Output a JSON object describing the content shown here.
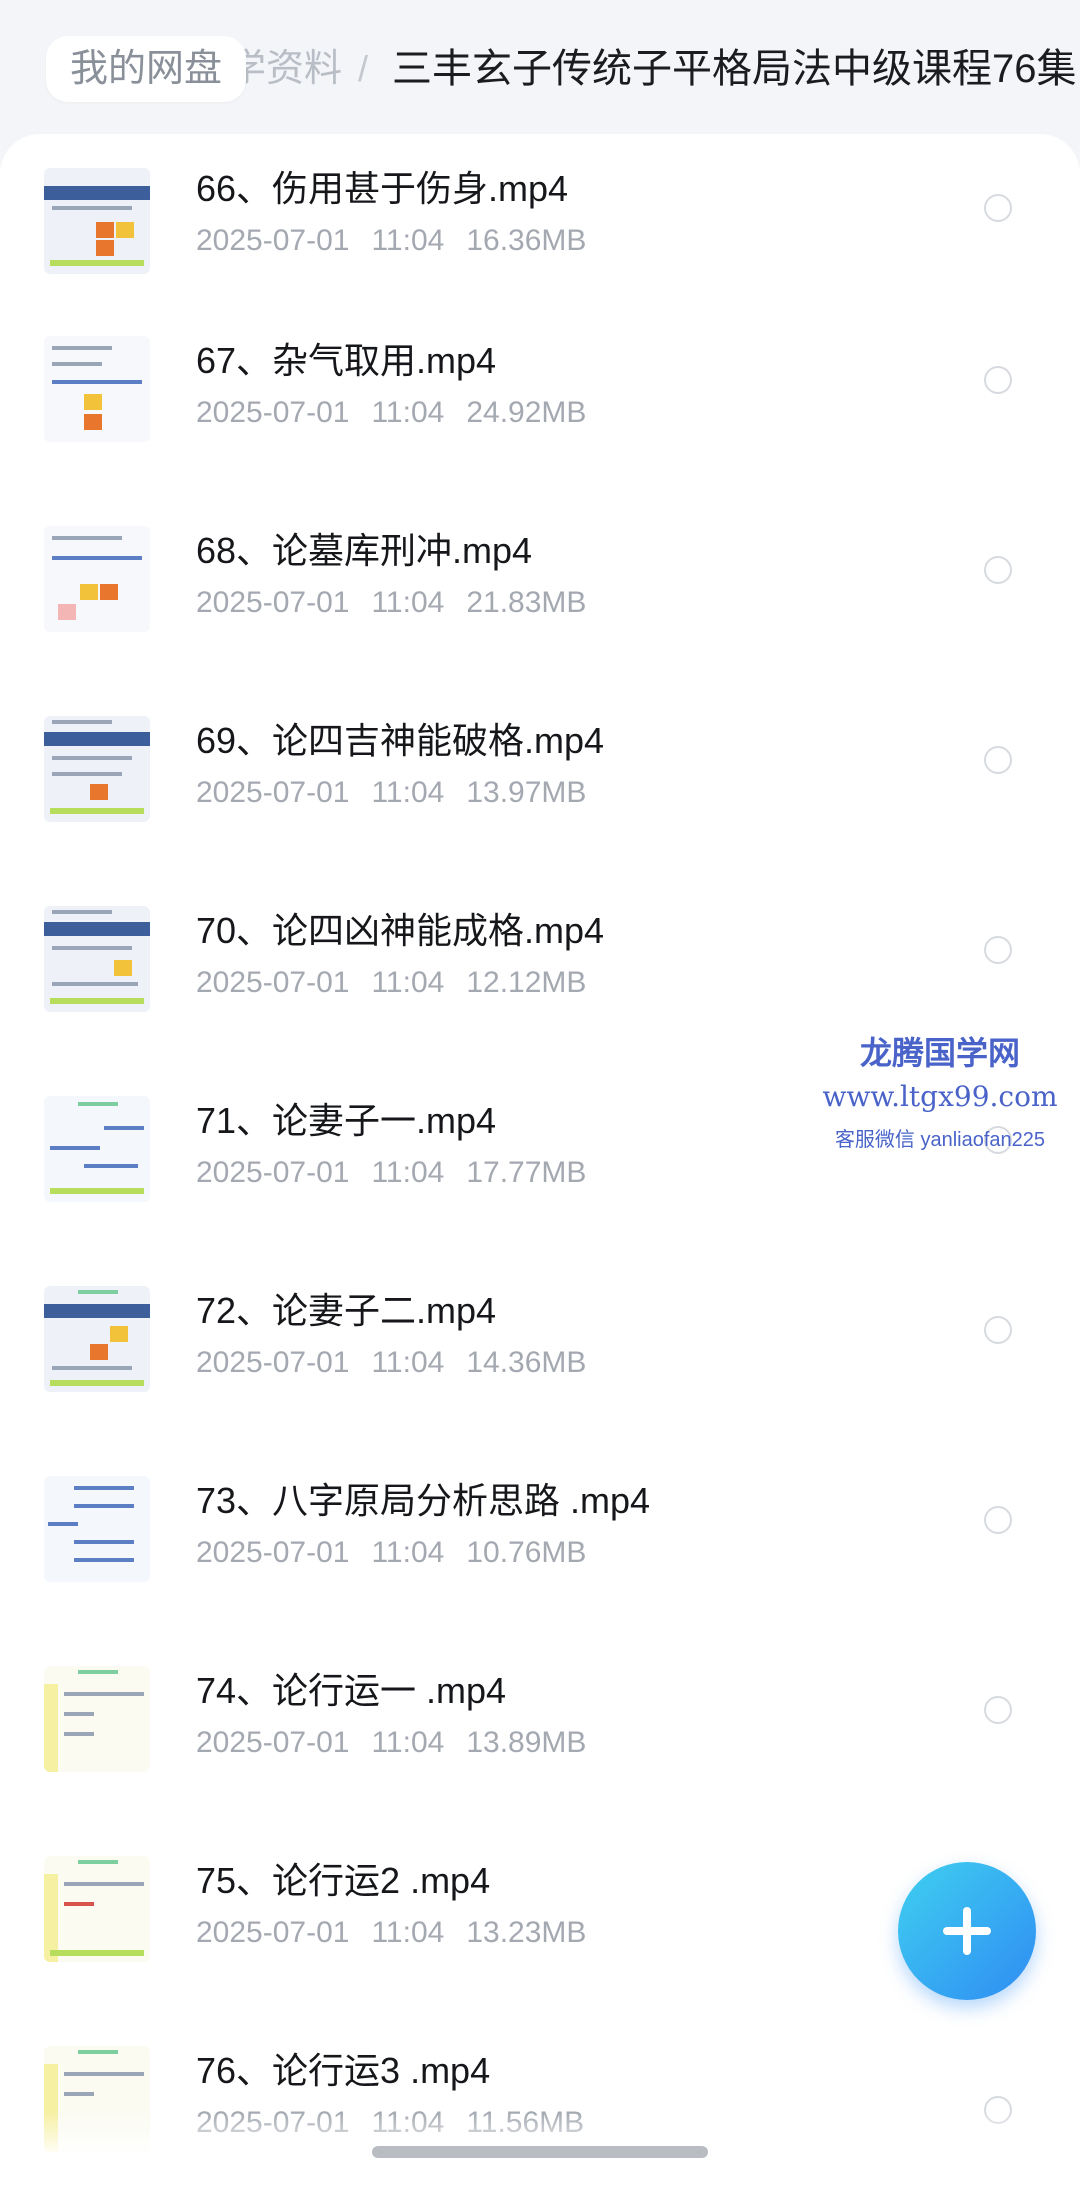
{
  "header": {
    "root": "我的网盘",
    "middle": "学资料",
    "separator": "/",
    "current": "三丰玄子传统子平格局法中级课程76集"
  },
  "files": [
    {
      "name": "66、伤用甚于伤身.mp4",
      "date": "2025-07-01",
      "time": "11:04",
      "size": "16.36MB"
    },
    {
      "name": "67、杂气取用.mp4",
      "date": "2025-07-01",
      "time": "11:04",
      "size": "24.92MB"
    },
    {
      "name": "68、论墓库刑冲.mp4",
      "date": "2025-07-01",
      "time": "11:04",
      "size": "21.83MB"
    },
    {
      "name": "69、论四吉神能破格.mp4",
      "date": "2025-07-01",
      "time": "11:04",
      "size": "13.97MB"
    },
    {
      "name": "70、论四凶神能成格.mp4",
      "date": "2025-07-01",
      "time": "11:04",
      "size": "12.12MB"
    },
    {
      "name": "71、论妻子一.mp4",
      "date": "2025-07-01",
      "time": "11:04",
      "size": "17.77MB"
    },
    {
      "name": "72、论妻子二.mp4",
      "date": "2025-07-01",
      "time": "11:04",
      "size": "14.36MB"
    },
    {
      "name": "73、八字原局分析思路 .mp4",
      "date": "2025-07-01",
      "time": "11:04",
      "size": "10.76MB"
    },
    {
      "name": "74、论行运一 .mp4",
      "date": "2025-07-01",
      "time": "11:04",
      "size": "13.89MB"
    },
    {
      "name": "75、论行运2 .mp4",
      "date": "2025-07-01",
      "time": "11:04",
      "size": "13.23MB"
    },
    {
      "name": "76、论行运3 .mp4",
      "date": "2025-07-01",
      "time": "11:04",
      "size": "11.56MB"
    }
  ],
  "watermark": {
    "name": "龙腾国学网",
    "url": "www.ltgx99.com",
    "contact": "客服微信 yanliaofan225"
  },
  "icons": {
    "fab": "plus-icon",
    "row_select": "radio-circle-icon",
    "thumbnail": "video-thumbnail"
  },
  "colors": {
    "accent": "#2f8cf3",
    "watermark": "#4a63c9"
  }
}
